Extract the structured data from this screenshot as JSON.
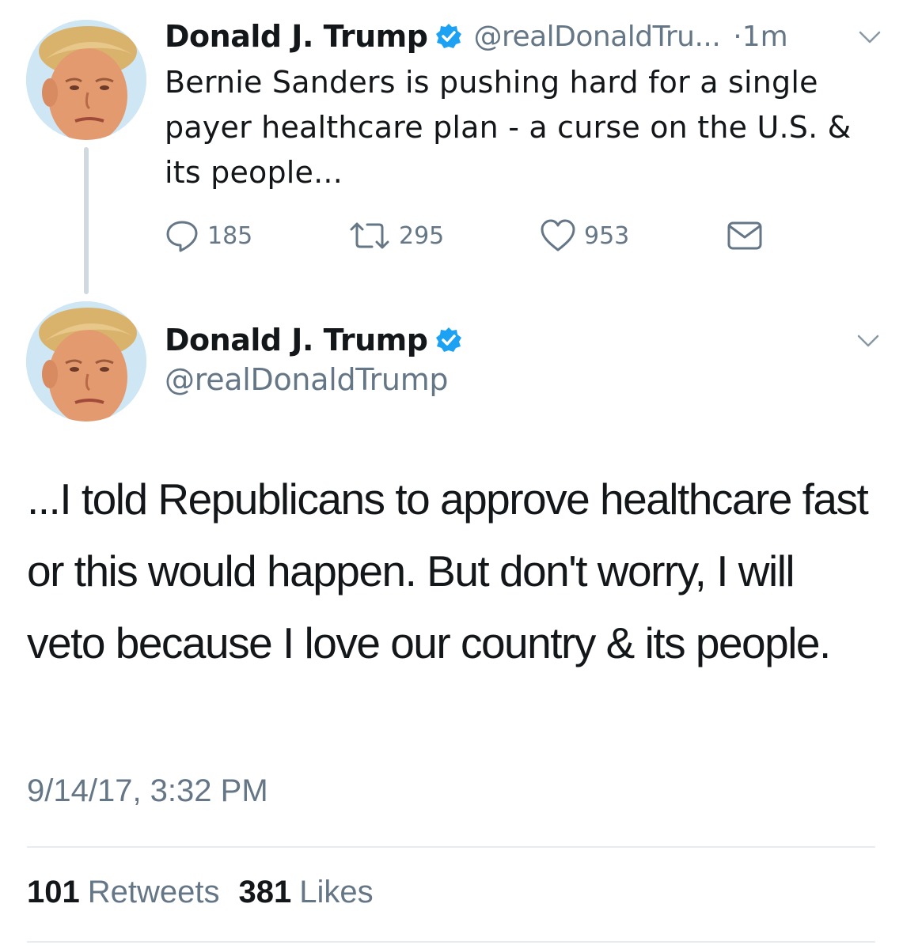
{
  "tweet1": {
    "author_name": "Donald J. Trump",
    "handle": "@realDonaldTru...",
    "time": "·1m",
    "text": "Bernie Sanders is pushing hard for a single payer healthcare plan - a curse on the U.S. & its people...",
    "replies": "185",
    "retweets": "295",
    "likes": "953"
  },
  "tweet2": {
    "author_name": "Donald J. Trump",
    "handle": "@realDonaldTrump",
    "text": "...I told Republicans to approve healthcare fast or this would happen. But don't worry, I will veto because I love our country & its people.",
    "timestamp": "9/14/17, 3:32 PM",
    "retweet_count": "101",
    "retweet_label": "Retweets",
    "like_count": "381",
    "like_label": "Likes"
  },
  "icons": {
    "verified": "verified-badge-icon",
    "reply": "reply-icon",
    "retweet": "retweet-icon",
    "like": "heart-icon",
    "dm": "envelope-icon",
    "menu": "chevron-down-icon"
  },
  "colors": {
    "verified_blue": "#1da1f2",
    "secondary_text": "#657786",
    "primary_text": "#14171a",
    "thread_line": "#cfd9de"
  }
}
